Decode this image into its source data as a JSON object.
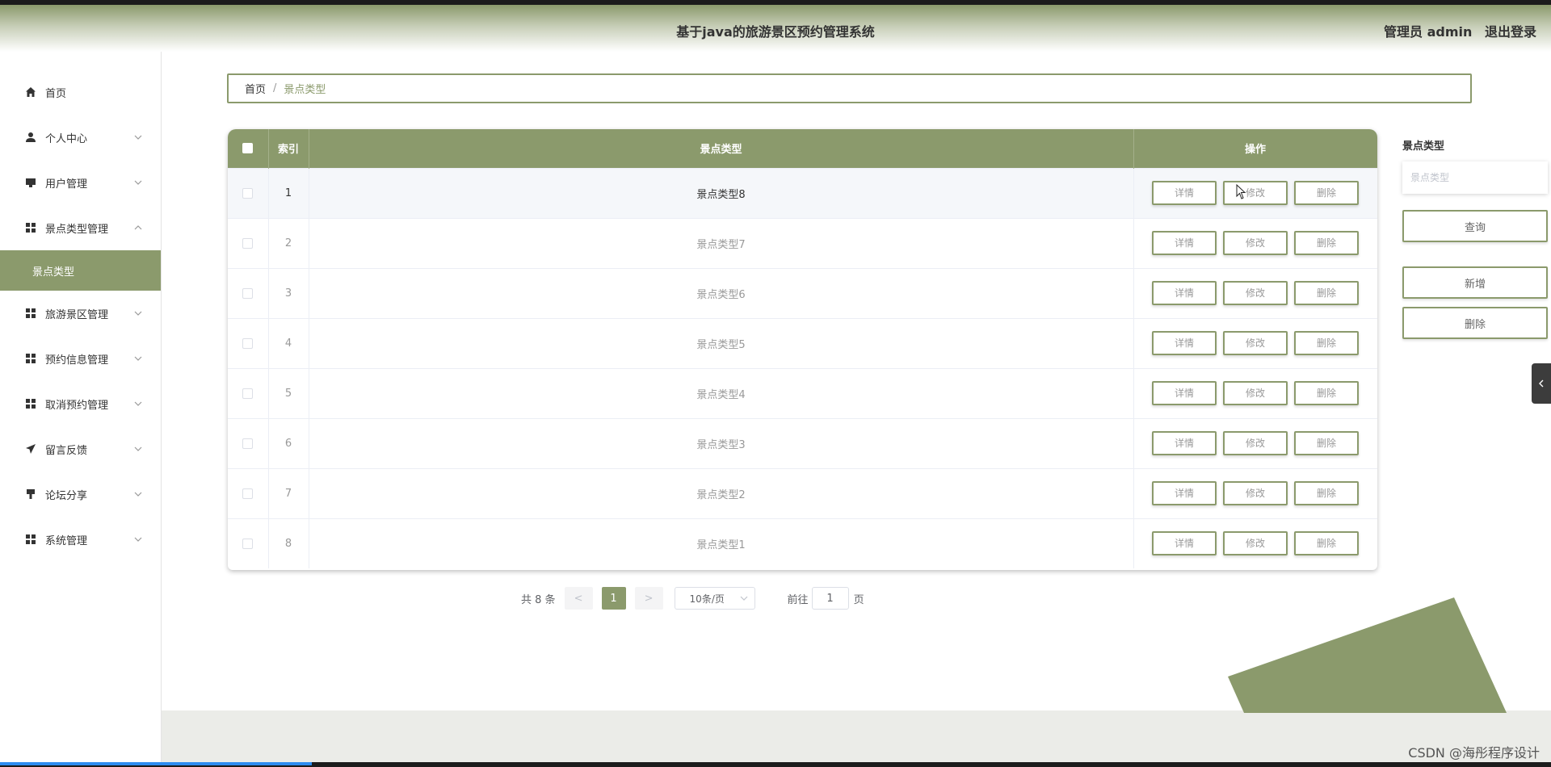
{
  "header": {
    "title": "基于java的旅游景区预约管理系统",
    "user_label": "管理员 admin",
    "logout_label": "退出登录"
  },
  "sidebar": {
    "items": [
      {
        "label": "首页",
        "icon": "home-icon",
        "expandable": false
      },
      {
        "label": "个人中心",
        "icon": "user-icon",
        "expandable": true
      },
      {
        "label": "用户管理",
        "icon": "monitor-icon",
        "expandable": true
      },
      {
        "label": "景点类型管理",
        "icon": "grid-icon",
        "expandable": true,
        "expanded": true
      },
      {
        "label": "旅游景区管理",
        "icon": "grid-icon",
        "expandable": true
      },
      {
        "label": "预约信息管理",
        "icon": "grid-icon",
        "expandable": true
      },
      {
        "label": "取消预约管理",
        "icon": "grid-icon",
        "expandable": true
      },
      {
        "label": "留言反馈",
        "icon": "send-icon",
        "expandable": true
      },
      {
        "label": "论坛分享",
        "icon": "brush-icon",
        "expandable": true
      },
      {
        "label": "系统管理",
        "icon": "grid-icon",
        "expandable": true
      }
    ],
    "active_subitem": "景点类型"
  },
  "breadcrumb": {
    "home": "首页",
    "separator": "/",
    "current": "景点类型"
  },
  "table": {
    "columns": [
      "索引",
      "景点类型",
      "操作"
    ],
    "rows": [
      {
        "index": "1",
        "name": "景点类型8"
      },
      {
        "index": "2",
        "name": "景点类型7"
      },
      {
        "index": "3",
        "name": "景点类型6"
      },
      {
        "index": "4",
        "name": "景点类型5"
      },
      {
        "index": "5",
        "name": "景点类型4"
      },
      {
        "index": "6",
        "name": "景点类型3"
      },
      {
        "index": "7",
        "name": "景点类型2"
      },
      {
        "index": "8",
        "name": "景点类型1"
      }
    ],
    "actions": {
      "detail": "详情",
      "edit": "修改",
      "delete": "删除"
    }
  },
  "pagination": {
    "total_text": "共 8 条",
    "prev": "<",
    "next": ">",
    "current_page": "1",
    "page_size": "10条/页",
    "goto_label": "前往",
    "goto_value": "1",
    "page_suffix": "页"
  },
  "search_panel": {
    "label": "景点类型",
    "placeholder": "景点类型",
    "query_button": "查询",
    "add_button": "新增",
    "delete_button": "删除"
  },
  "watermark": "CSDN @海彤程序设计",
  "colors": {
    "accent": "#8b9a6c",
    "header_gradient_top": "#8b9a6c",
    "progress": "#2d8cf0"
  }
}
